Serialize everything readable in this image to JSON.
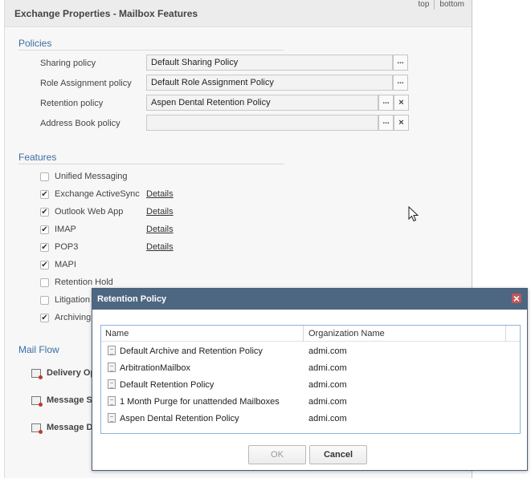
{
  "panel": {
    "title": "Exchange Properties - Mailbox Features"
  },
  "toplinks": {
    "top": "top",
    "bottom": "bottom"
  },
  "policies": {
    "section_title": "Policies",
    "rows": [
      {
        "label": "Sharing policy",
        "value": "Default Sharing Policy",
        "browse": "...",
        "clear": ""
      },
      {
        "label": "Role Assignment policy",
        "value": "Default Role Assignment Policy",
        "browse": "...",
        "clear": ""
      },
      {
        "label": "Retention policy",
        "value": "Aspen Dental Retention Policy",
        "browse": "...",
        "clear": "×"
      },
      {
        "label": "Address Book policy",
        "value": "",
        "browse": "...",
        "clear": "×"
      }
    ]
  },
  "features": {
    "section_title": "Features",
    "items": [
      {
        "label": "Unified Messaging",
        "checked": false,
        "details": ""
      },
      {
        "label": "Exchange ActiveSync",
        "checked": true,
        "details": "Details"
      },
      {
        "label": "Outlook Web App",
        "checked": true,
        "details": "Details"
      },
      {
        "label": "IMAP",
        "checked": true,
        "details": "Details"
      },
      {
        "label": "POP3",
        "checked": true,
        "details": "Details"
      },
      {
        "label": "MAPI",
        "checked": true,
        "details": ""
      },
      {
        "label": "Retention Hold",
        "checked": false,
        "details": ""
      },
      {
        "label": "Litigation H",
        "checked": false,
        "details": ""
      },
      {
        "label": "Archiving",
        "checked": true,
        "details": ""
      }
    ],
    "check_glyph": "✔"
  },
  "mail_flow": {
    "section_title": "Mail Flow",
    "items": [
      {
        "label": "Delivery Op",
        "icon": "delivery-options-icon"
      },
      {
        "label": "Message Si",
        "icon": "message-size-icon"
      },
      {
        "label": "Message D",
        "icon": "message-delivery-icon"
      }
    ]
  },
  "dialog": {
    "title": "Retention Policy",
    "close_glyph": "×",
    "columns": {
      "name": "Name",
      "org": "Organization Name"
    },
    "rows": [
      {
        "name": "Default Archive and Retention Policy",
        "org": "admi.com"
      },
      {
        "name": "ArbitrationMailbox",
        "org": "admi.com"
      },
      {
        "name": "Default Retention Policy",
        "org": "admi.com"
      },
      {
        "name": "1 Month Purge for unattended Mailboxes",
        "org": "admi.com"
      },
      {
        "name": "Aspen Dental Retention Policy",
        "org": "admi.com"
      }
    ],
    "ok_label": "OK",
    "cancel_label": "Cancel"
  }
}
